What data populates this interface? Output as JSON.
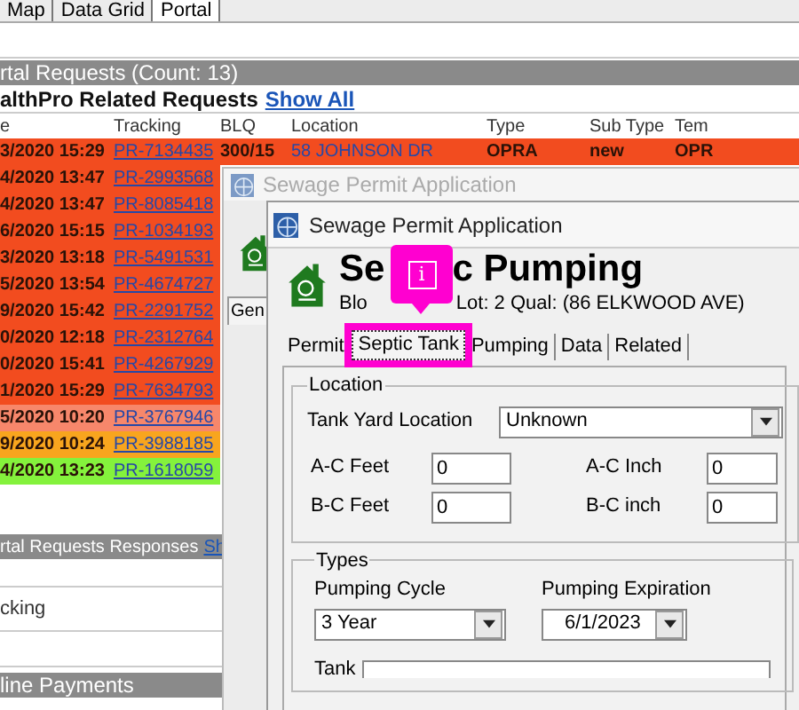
{
  "top_tabs": [
    {
      "label": "Map",
      "selected": false
    },
    {
      "label": "Data Grid",
      "selected": false
    },
    {
      "label": "Portal",
      "selected": true
    }
  ],
  "requests": {
    "header": "rtal Requests (Count: 13)",
    "subheader": "althPro Related Requests",
    "link": "Show All",
    "columns": [
      "e",
      "Tracking",
      "BLQ",
      "Location",
      "Type",
      "Sub Type",
      "Tem"
    ],
    "rows": [
      {
        "color": "#f24c1f",
        "cells": [
          "3/2020 15:29",
          "PR-7134435",
          "300/15",
          "58 JOHNSON DR",
          "OPRA",
          "new",
          "OPR"
        ]
      },
      {
        "color": "#f24c1f",
        "cells": [
          "4/2020 13:47",
          "PR-2993568"
        ]
      },
      {
        "color": "#f24c1f",
        "cells": [
          "4/2020 13:47",
          "PR-8085418"
        ]
      },
      {
        "color": "#f24c1f",
        "cells": [
          "6/2020 15:15",
          "PR-1034193"
        ]
      },
      {
        "color": "#f24c1f",
        "cells": [
          "3/2020 13:18",
          "PR-5491531"
        ]
      },
      {
        "color": "#f24c1f",
        "cells": [
          "5/2020 13:54",
          "PR-4674727"
        ]
      },
      {
        "color": "#f24c1f",
        "cells": [
          "9/2020 15:42",
          "PR-2291752"
        ]
      },
      {
        "color": "#f24c1f",
        "cells": [
          "0/2020 12:18",
          "PR-2312764"
        ]
      },
      {
        "color": "#f24c1f",
        "cells": [
          "0/2020 15:41",
          "PR-4267929"
        ]
      },
      {
        "color": "#f24c1f",
        "cells": [
          "1/2020 15:29",
          "PR-7634793"
        ]
      },
      {
        "color": "#f7876b",
        "cells": [
          "5/2020 10:20",
          "PR-3767946"
        ]
      },
      {
        "color": "#f8a51e",
        "cells": [
          "9/2020 10:24",
          "PR-3988185"
        ]
      },
      {
        "color": "#84f23c",
        "cells": [
          "4/2020 13:23",
          "PR-1618059"
        ]
      }
    ]
  },
  "responses": {
    "header": "rtal Requests Responses",
    "link": "Sh",
    "label": "cking"
  },
  "payments": {
    "header": "line Payments"
  },
  "back_dialog": {
    "title": "Sewage Permit Application",
    "tab": "Gen"
  },
  "dialog": {
    "title": "Sewage Permit Application",
    "heading_start": "Se",
    "heading_end": "c Pumping",
    "subtitle_start": "Blo",
    "subtitle_end": "Lot: 2 Qual:  (86 ELKWOOD AVE)",
    "tabs": [
      {
        "label": "Permit",
        "selected": false
      },
      {
        "label": "Septic Tank",
        "selected": true
      },
      {
        "label": "Pumping",
        "selected": false
      },
      {
        "label": "Data",
        "selected": false
      },
      {
        "label": "Related",
        "selected": false
      }
    ],
    "location": {
      "legend": "Location",
      "tank_yard_label": "Tank Yard Location",
      "tank_yard_value": "Unknown",
      "fields": [
        {
          "label": "A-C Feet",
          "value": "0"
        },
        {
          "label": "A-C Inch",
          "value": "0"
        },
        {
          "label": "B-C Feet",
          "value": "0"
        },
        {
          "label": "B-C inch",
          "value": "0"
        }
      ]
    },
    "types": {
      "legend": "Types",
      "cycle_label": "Pumping Cycle",
      "cycle_value": "3 Year",
      "expiration_label": "Pumping Expiration",
      "expiration_value": "6/1/2023",
      "tank_label": "Tank"
    }
  },
  "callout": {
    "label": "i"
  }
}
